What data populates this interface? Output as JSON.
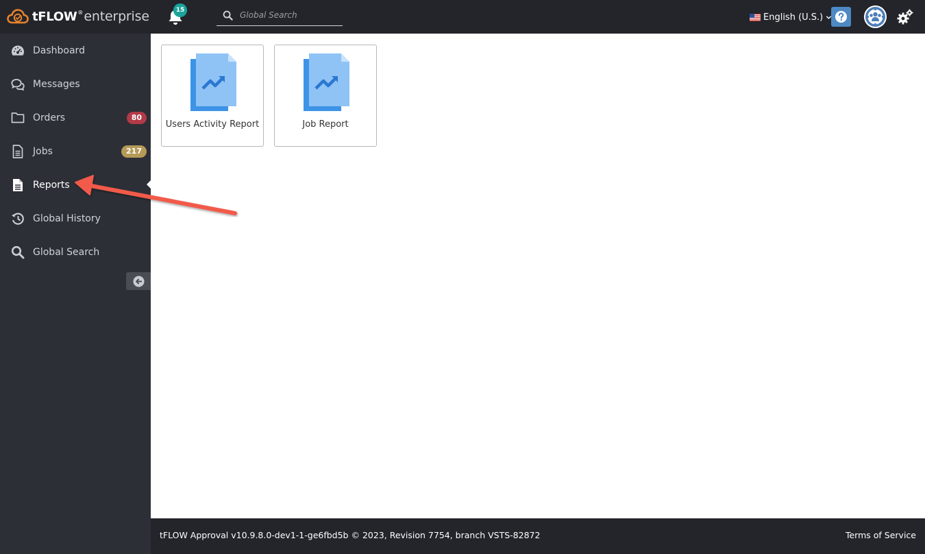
{
  "header": {
    "brand": "tFLOW",
    "brand_reg": "®",
    "brand_sub": "enterprise",
    "notification_count": "15",
    "search_placeholder": "Global Search",
    "language": "English (U.S.)",
    "icons": {
      "logo": "cloud-check-icon",
      "notifications": "bell-icon",
      "search": "search-icon",
      "flag": "us-flag-icon",
      "language_dropdown": "chevron-down-icon",
      "help": "question-icon",
      "avatar": "user-group-gear-icon",
      "settings": "gears-icon"
    }
  },
  "sidebar": {
    "items": [
      {
        "label": "Dashboard",
        "icon": "dashboard-gauge-icon",
        "badge": null
      },
      {
        "label": "Messages",
        "icon": "comments-icon",
        "badge": null
      },
      {
        "label": "Orders",
        "icon": "folder-icon",
        "badge": "80"
      },
      {
        "label": "Jobs",
        "icon": "document-icon",
        "badge": "217"
      },
      {
        "label": "Reports",
        "icon": "report-file-icon",
        "badge": null,
        "active": true
      },
      {
        "label": "Global History",
        "icon": "history-icon",
        "badge": null
      },
      {
        "label": "Global Search",
        "icon": "search-icon",
        "badge": null
      }
    ],
    "collapse_icon": "arrow-left-circle-icon"
  },
  "main": {
    "reports": [
      {
        "label": "Users Activity Report",
        "icon": "report-chart-icon"
      },
      {
        "label": "Job Report",
        "icon": "report-chart-icon"
      }
    ]
  },
  "footer": {
    "version": "tFLOW Approval v10.9.8.0-dev1-1-ge6fbd5b © 2023, Revision 7754, branch VSTS-82872",
    "terms": "Terms of Service"
  },
  "colors": {
    "topbar": "#23252b",
    "sidebar": "#2c2f36",
    "brand_orange": "#e8822b",
    "notification_badge": "#1ba39c",
    "orders_badge": "#b23a48",
    "jobs_badge": "#b59a58",
    "help_button": "#4e89c4",
    "report_icon_dark": "#3d93e6",
    "report_icon_light": "#8fc3f5",
    "annotation_arrow": "#f25a4a"
  }
}
